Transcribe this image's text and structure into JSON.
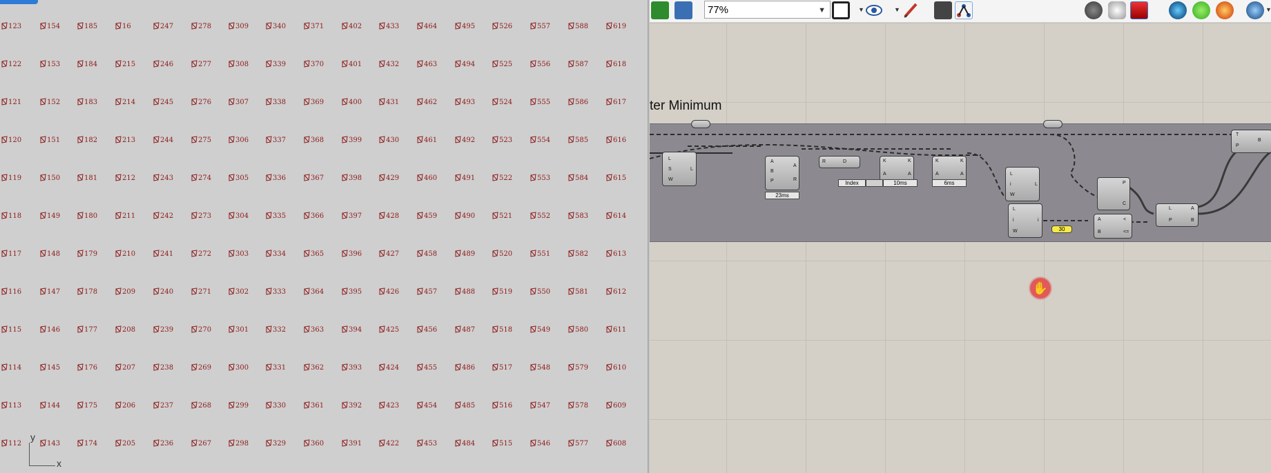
{
  "viewport": {
    "axis_x": "x",
    "axis_y": "y",
    "labels": [
      [
        "123",
        "154",
        "185",
        "16",
        "247",
        "278",
        "309",
        "340",
        "371",
        "402",
        "433",
        "464",
        "495",
        "526",
        "557",
        "588",
        "619"
      ],
      [
        "122",
        "153",
        "184",
        "215",
        "246",
        "277",
        "308",
        "339",
        "370",
        "401",
        "432",
        "463",
        "494",
        "525",
        "556",
        "587",
        "618"
      ],
      [
        "121",
        "152",
        "183",
        "214",
        "245",
        "276",
        "307",
        "338",
        "369",
        "400",
        "431",
        "462",
        "493",
        "524",
        "555",
        "586",
        "617"
      ],
      [
        "120",
        "151",
        "182",
        "213",
        "244",
        "275",
        "306",
        "337",
        "368",
        "399",
        "430",
        "461",
        "492",
        "523",
        "554",
        "585",
        "616"
      ],
      [
        "119",
        "150",
        "181",
        "212",
        "243",
        "274",
        "305",
        "336",
        "367",
        "398",
        "429",
        "460",
        "491",
        "522",
        "553",
        "584",
        "615"
      ],
      [
        "118",
        "149",
        "180",
        "211",
        "242",
        "273",
        "304",
        "335",
        "366",
        "397",
        "428",
        "459",
        "490",
        "521",
        "552",
        "583",
        "614"
      ],
      [
        "117",
        "148",
        "179",
        "210",
        "241",
        "272",
        "303",
        "334",
        "365",
        "396",
        "427",
        "458",
        "489",
        "520",
        "551",
        "582",
        "613"
      ],
      [
        "116",
        "147",
        "178",
        "209",
        "240",
        "271",
        "302",
        "333",
        "364",
        "395",
        "426",
        "457",
        "488",
        "519",
        "550",
        "581",
        "612"
      ],
      [
        "115",
        "146",
        "177",
        "208",
        "239",
        "270",
        "301",
        "332",
        "363",
        "394",
        "425",
        "456",
        "487",
        "518",
        "549",
        "580",
        "611"
      ],
      [
        "114",
        "145",
        "176",
        "207",
        "238",
        "269",
        "300",
        "331",
        "362",
        "393",
        "424",
        "455",
        "486",
        "517",
        "548",
        "579",
        "610"
      ],
      [
        "113",
        "144",
        "175",
        "206",
        "237",
        "268",
        "299",
        "330",
        "361",
        "392",
        "423",
        "454",
        "485",
        "516",
        "547",
        "578",
        "609"
      ],
      [
        "112",
        "143",
        "174",
        "205",
        "236",
        "267",
        "298",
        "329",
        "360",
        "391",
        "422",
        "453",
        "484",
        "515",
        "546",
        "577",
        "608"
      ]
    ]
  },
  "toolbar": {
    "zoom_value": "77%",
    "colors": {
      "accent": "#2d7bd6"
    }
  },
  "canvas": {
    "group_title": "ter Minimum",
    "components": {
      "c1_pins": [
        "L",
        "S",
        "W",
        "L"
      ],
      "c2_pins": [
        "A",
        "B",
        "P",
        "A",
        "R"
      ],
      "c2_time": "23ms",
      "c3_pins": [
        "R",
        "D"
      ],
      "c4_pins": [
        "K",
        "A",
        "K",
        "A"
      ],
      "c4_time": "10ms",
      "c5_pins": [
        "K",
        "A",
        "K",
        "A"
      ],
      "c5_time": "6ms",
      "index_label": "Index",
      "c6_pins": [
        "L",
        "i",
        "W",
        "L"
      ],
      "c7_pins": [
        "L",
        "i",
        "W",
        "i"
      ],
      "c8_pins": [
        "P",
        "C"
      ],
      "c9_pins": [
        "A",
        "B",
        "<",
        "<="
      ],
      "panel_value": "30",
      "c10_pins": [
        "L",
        "P",
        "A",
        "B"
      ],
      "c11_pins": [
        "T",
        "P",
        "B"
      ]
    }
  }
}
